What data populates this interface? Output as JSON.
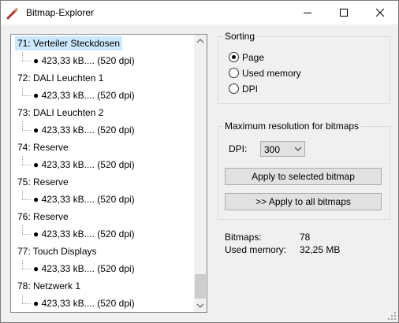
{
  "window": {
    "title": "Bitmap-Explorer",
    "icon": "pen-icon"
  },
  "tree": {
    "nodes": [
      {
        "label": "71: Verteiler Steckdosen",
        "child": "423,33 kB.... (520 dpi)",
        "selected": true
      },
      {
        "label": "72: DALI Leuchten 1",
        "child": "423,33 kB.... (520 dpi)"
      },
      {
        "label": "73: DALI Leuchten 2",
        "child": "423,33 kB.... (520 dpi)"
      },
      {
        "label": "74: Reserve",
        "child": "423,33 kB.... (520 dpi)"
      },
      {
        "label": "75: Reserve",
        "child": "423,33 kB.... (520 dpi)"
      },
      {
        "label": "76: Reserve",
        "child": "423,33 kB.... (520 dpi)"
      },
      {
        "label": "77: Touch Displays",
        "child": "423,33 kB.... (520 dpi)"
      },
      {
        "label": "78: Netzwerk 1",
        "child": "423,33 kB.... (520 dpi)"
      }
    ]
  },
  "sorting": {
    "title": "Sorting",
    "options": [
      "Page",
      "Used memory",
      "DPI"
    ],
    "selected": "Page"
  },
  "resolution": {
    "title": "Maximum resolution for bitmaps",
    "dpi_label": "DPI:",
    "dpi_value": "300",
    "apply_selected_label": "Apply to selected bitmap",
    "apply_all_label": ">>  Apply to all bitmaps"
  },
  "stats": {
    "bitmaps_label": "Bitmaps:",
    "bitmaps_value": "78",
    "memory_label": "Used memory:",
    "memory_value": "32,25 MB"
  },
  "colors": {
    "selection": "#cce8ff",
    "scroll_thumb": "#cdcdcd"
  }
}
